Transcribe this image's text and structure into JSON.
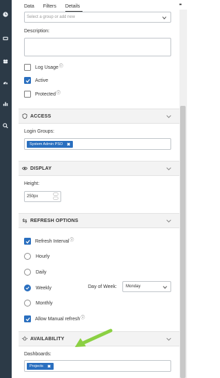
{
  "tabs": [
    "Data",
    "Filters",
    "Details"
  ],
  "active_tab": "Details",
  "group_select": {
    "placeholder": "Select a group or add new"
  },
  "description": {
    "label": "Description:",
    "value": ""
  },
  "checks_top": [
    {
      "label": "Log Usage",
      "checked": false,
      "info": "ⓘ"
    },
    {
      "label": "Active",
      "checked": true,
      "info": ""
    },
    {
      "label": "Protected",
      "checked": false,
      "info": "ⓘ"
    }
  ],
  "access": {
    "title": "ACCESS",
    "login_groups_label": "Login Groups:",
    "login_group_chip": "System Admin PSO",
    "chip_remove": "✖"
  },
  "display": {
    "title": "DISPLAY",
    "height_label": "Height:",
    "height_value": "250px"
  },
  "refresh": {
    "title": "REFRESH OPTIONS",
    "refresh_interval": {
      "label": "Refresh Interval",
      "checked": true,
      "info": "ⓘ"
    },
    "options": [
      {
        "label": "Hourly",
        "checked": false
      },
      {
        "label": "Daily",
        "checked": false
      },
      {
        "label": "Weekly",
        "checked": true
      },
      {
        "label": "Monthly",
        "checked": false
      }
    ],
    "day_of_week_label": "Day of Week:",
    "day_of_week_value": "Monday",
    "allow_manual": {
      "label": "Allow Manual refresh",
      "checked": true,
      "info": "ⓘ"
    }
  },
  "availability": {
    "title": "AVAILABILITY",
    "dashboards_label": "Dashboards:",
    "dashboard_chip": "Projects",
    "chip_remove": "✖"
  },
  "ellipsis": "•••",
  "colors": {
    "rail": "#2c3a47",
    "accent": "#2a6fbf",
    "arrow": "#8bd043"
  }
}
